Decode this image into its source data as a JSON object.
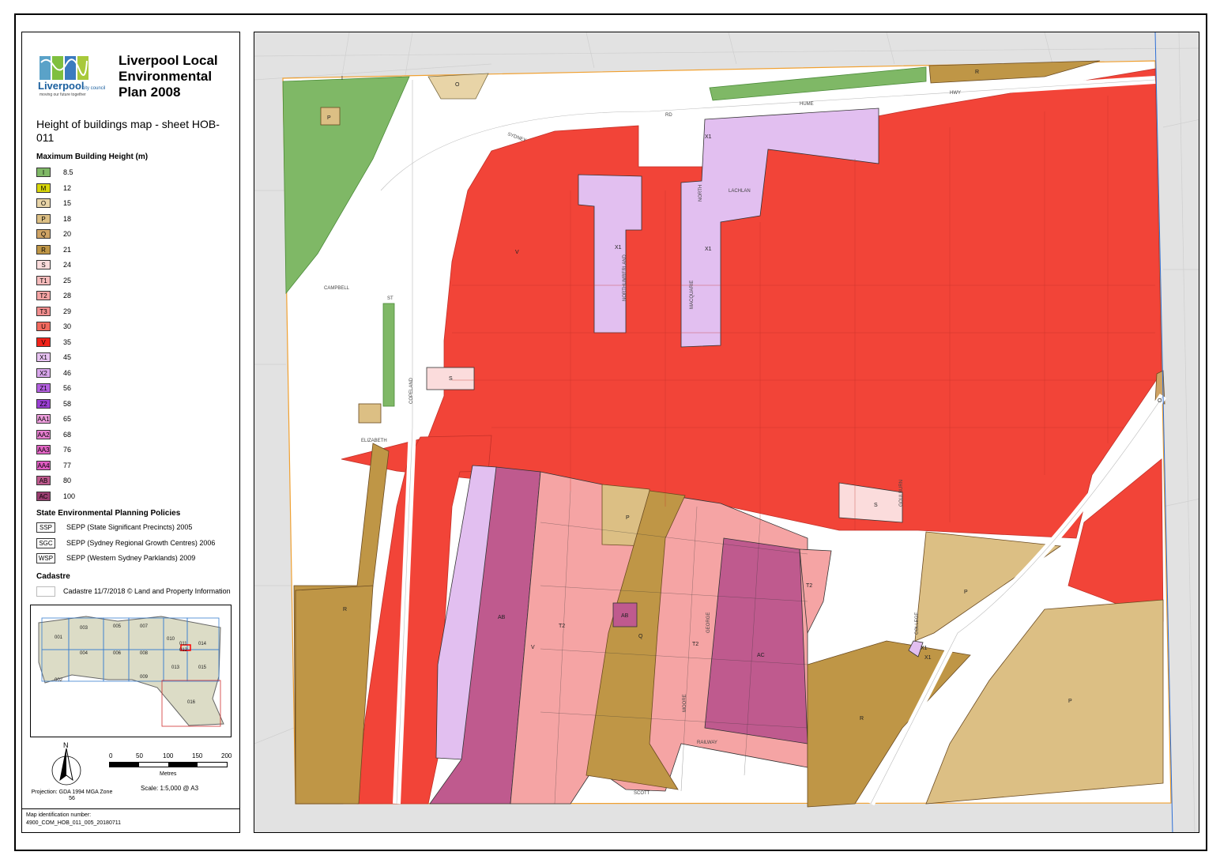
{
  "header": {
    "org_name": "Liverpool",
    "org_suffix": "city council",
    "org_tagline": "moving our future together",
    "title": "Liverpool Local Environmental Plan 2008",
    "subtitle": "Height of buildings map - sheet HOB-011"
  },
  "legend": {
    "heading": "Maximum Building Height (m)",
    "items": [
      {
        "code": "I",
        "value": "8.5",
        "color": "#7fb866"
      },
      {
        "code": "M",
        "value": "12",
        "color": "#d8d60a"
      },
      {
        "code": "O",
        "value": "15",
        "color": "#e8d4a7"
      },
      {
        "code": "P",
        "value": "18",
        "color": "#dcbf84"
      },
      {
        "code": "Q",
        "value": "20",
        "color": "#cfa364"
      },
      {
        "code": "R",
        "value": "21",
        "color": "#bf9646"
      },
      {
        "code": "S",
        "value": "24",
        "color": "#fbdcdc"
      },
      {
        "code": "T1",
        "value": "25",
        "color": "#f7bcbc"
      },
      {
        "code": "T2",
        "value": "28",
        "color": "#f5a4a4"
      },
      {
        "code": "T3",
        "value": "29",
        "color": "#f28e8e"
      },
      {
        "code": "U",
        "value": "30",
        "color": "#f26a5e"
      },
      {
        "code": "V",
        "value": "35",
        "color": "#f2231a"
      },
      {
        "code": "X1",
        "value": "45",
        "color": "#e7c2f2"
      },
      {
        "code": "X2",
        "value": "46",
        "color": "#d9a6ec"
      },
      {
        "code": "Z1",
        "value": "56",
        "color": "#b460e0"
      },
      {
        "code": "Z2",
        "value": "58",
        "color": "#9a3fd3"
      },
      {
        "code": "AA1",
        "value": "65",
        "color": "#ef9fde"
      },
      {
        "code": "AA2",
        "value": "68",
        "color": "#e87ed0"
      },
      {
        "code": "AA3",
        "value": "76",
        "color": "#e365c5"
      },
      {
        "code": "AA4",
        "value": "77",
        "color": "#e05cc2"
      },
      {
        "code": "AB",
        "value": "80",
        "color": "#bf5a8e"
      },
      {
        "code": "AC",
        "value": "100",
        "color": "#9a3d70"
      }
    ]
  },
  "sepp": {
    "heading": "State Environmental Planning Policies",
    "items": [
      {
        "code": "SSP",
        "label": "SEPP (State Significant Precincts) 2005"
      },
      {
        "code": "SGC",
        "label": "SEPP (Sydney Regional Growth Centres) 2006"
      },
      {
        "code": "WSP",
        "label": "SEPP (Western Sydney Parklands) 2009"
      }
    ]
  },
  "cadastre": {
    "heading": "Cadastre",
    "label": "Cadastre 11/7/2018 © Land and Property Information"
  },
  "inset_sheets": [
    "001",
    "002",
    "003",
    "004",
    "005",
    "006",
    "007",
    "008",
    "009",
    "010",
    "011",
    "012",
    "013",
    "014",
    "015",
    "016"
  ],
  "north": "N",
  "projection": "Projection: GDA 1994 MGA Zone 56",
  "scale": {
    "ticks": [
      "0",
      "50",
      "100",
      "150",
      "200"
    ],
    "unit": "Metres",
    "text": "Scale: 1:5,000 @ A3"
  },
  "map_id": {
    "label": "Map identification number:",
    "value": "4900_COM_HOB_011_005_20180711"
  },
  "map": {
    "zone_labels": [
      "I",
      "O",
      "R",
      "P",
      "X1",
      "X1",
      "X1",
      "X1",
      "S",
      "S",
      "P",
      "V",
      "V",
      "T2",
      "T2",
      "T2",
      "AB",
      "AB",
      "AC",
      "P",
      "P",
      "R",
      "R",
      "Q",
      "O",
      "X1"
    ],
    "streets": [
      "SYDNEY",
      "RD",
      "HUME",
      "HWY",
      "CAMPBELL",
      "ST",
      "ELIZABETH",
      "COPELAND",
      "NORTHUMBERLAND",
      "MACQUARIE",
      "NORTH",
      "LACHLAN",
      "RAILWAY",
      "SCOTT",
      "MOORE",
      "GEORGE",
      "COLLEGE",
      "GOULBURN"
    ]
  }
}
